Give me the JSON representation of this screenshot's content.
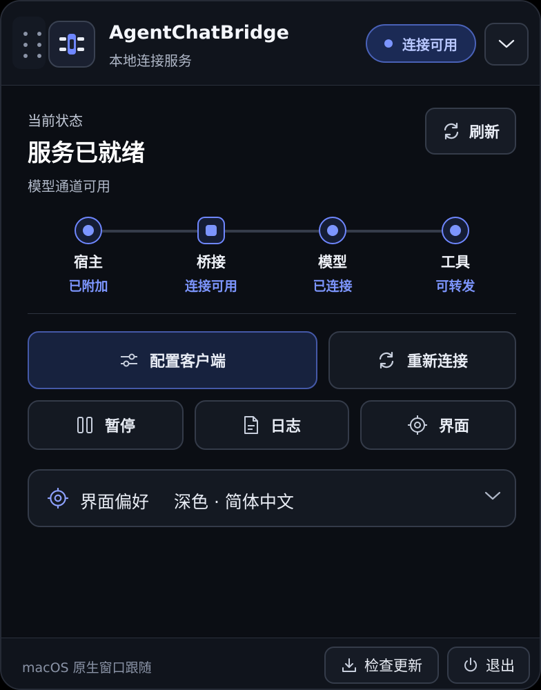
{
  "header": {
    "title": "AgentChatBridge",
    "subtitle": "本地连接服务",
    "status": "连接可用",
    "drag_icon": "grip-dots-icon",
    "app_icon": "bridge-logo-icon",
    "collapse_icon": "chevron-down-icon"
  },
  "status": {
    "label": "当前状态",
    "title": "服务已就绪",
    "description": "模型通道可用",
    "refresh_label": "刷新"
  },
  "steps": [
    {
      "name": "宿主",
      "state": "已附加"
    },
    {
      "name": "桥接",
      "state": "连接可用"
    },
    {
      "name": "模型",
      "state": "已连接"
    },
    {
      "name": "工具",
      "state": "可转发"
    }
  ],
  "actions": {
    "configure_client": "配置客户端",
    "reconnect": "重新连接",
    "pause": "暂停",
    "logs": "日志",
    "interface": "界面"
  },
  "preferences": {
    "label": "界面偏好",
    "value": "深色 · 简体中文"
  },
  "footer": {
    "note": "macOS 原生窗口跟随",
    "check_update": "检查更新",
    "quit": "退出"
  },
  "colors": {
    "accent": "#7c95ff",
    "background": "#0b0e14",
    "panel": "#141922"
  }
}
